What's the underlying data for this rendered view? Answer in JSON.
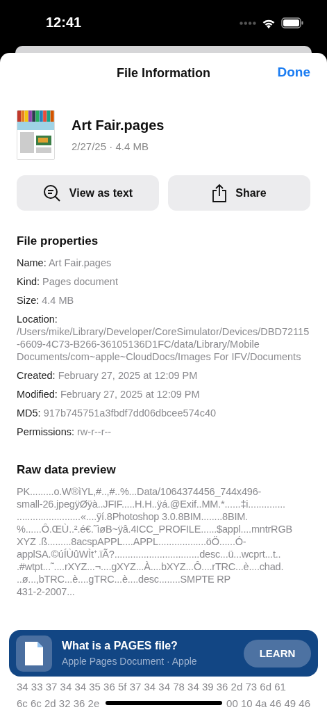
{
  "status_bar": {
    "time": "12:41"
  },
  "header": {
    "title": "File Information",
    "done": "Done"
  },
  "file": {
    "name": "Art Fair.pages",
    "meta": "2/27/25 · 4.4 MB"
  },
  "actions": [
    {
      "kind": "view",
      "label": "View as text"
    },
    {
      "kind": "share",
      "label": "Share"
    }
  ],
  "properties": {
    "heading": "File properties",
    "rows": [
      {
        "label": "Name:",
        "value": "Art Fair.pages"
      },
      {
        "label": "Kind:",
        "value": "Pages document"
      },
      {
        "label": "Size:",
        "value": "4.4 MB"
      },
      {
        "label": "Location:",
        "value": "/Users/mike/Library/Developer/CoreSimulator/Devices/DBD72115-6609-4C73-B266-36105136D1FC/data/Library/Mobile Documents/com~apple~CloudDocs/Images For IFV/Documents"
      },
      {
        "label": "Created:",
        "value": "February 27, 2025 at 12:09 PM"
      },
      {
        "label": "Modified:",
        "value": "February 27, 2025 at 12:09 PM"
      },
      {
        "label": "MD5:",
        "value": "917b745751a3fbdf7dd06dbcee574c40"
      },
      {
        "label": "Permissions:",
        "value": "rw-r--r--"
      }
    ]
  },
  "raw_preview": {
    "heading": "Raw data preview",
    "lines": [
      "PK.........o.W®ìYL,#..,#..%...Data/1064374456_744x496-",
      "small-26.jpegÿØÿà..JFIF.....H.H..ÿá.@Exif..MM.*......‡i..............",
      "........................«....ÿí.8Photoshop 3.0.8BIM........8BIM.",
      "%......Ô.ŒÙ..².é€.˜ìøB~ÿâ.4ICC_PROFILE......$appl....mntrRGB",
      "XYZ .ß.........8acspAPPL....APPL..................öÖ......Ó-",
      "applSA.©úÍÙûWÌt⁺.ïÃ?................................desc...ü...wcprt...t..",
      ".#wtpt...˜....rXYZ...¬....gXYZ...À....bXYZ...Ô....rTRC...è....chad.",
      "..ø...,bTRC...è....gTRC...è....desc........SMPTE RP",
      "431-2-2007..."
    ]
  },
  "hex_lines": [
    [
      "34 33 37 34 34 35 36 5f 37 34 34 78 34 39 36 2d 73 6d 61"
    ],
    [
      "6c 6c 2d 32 36 2e",
      "00 10 4a 46 49 46"
    ]
  ],
  "banner": {
    "title": "What is a PAGES file?",
    "subtitle": "Apple Pages Document · Apple",
    "button": "LEARN"
  }
}
